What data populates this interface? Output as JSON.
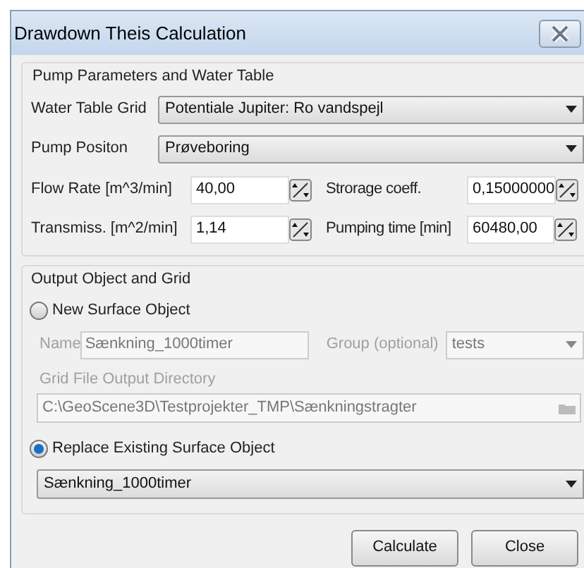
{
  "window": {
    "title": "Drawdown Theis Calculation"
  },
  "pump_group": {
    "title": "Pump Parameters and Water Table",
    "dropdowns": [
      {
        "label": "Water Table Grid",
        "value": "Potentiale Jupiter: Ro vandspejl"
      },
      {
        "label": "Pump Positon",
        "value": "Prøveboring"
      }
    ],
    "spin_fields": [
      {
        "label": "Flow Rate [m^3/min]",
        "value": "40,00"
      },
      {
        "label": "Strorage coeff.",
        "value": "0,15000000"
      },
      {
        "label": "Transmiss. [m^2/min]",
        "value": "1,14"
      },
      {
        "label": "Pumping time [min]",
        "value": "60480,00"
      }
    ]
  },
  "output_group": {
    "title": "Output Object and Grid",
    "new_surface": {
      "label": "New Surface Object",
      "selected": false,
      "disabled": true,
      "name_label": "Name",
      "name_value": "Sænkning_1000timer",
      "group_label": "Group (optional)",
      "group_value": "tests",
      "dir_label": "Grid File Output Directory",
      "dir_value": "C:\\GeoScene3D\\Testprojekter_TMP\\Sænkningstragter"
    },
    "replace_surface": {
      "label": "Replace Existing Surface Object",
      "selected": true,
      "value": "Sænkning_1000timer"
    }
  },
  "buttons": [
    "Calculate",
    "Close"
  ]
}
